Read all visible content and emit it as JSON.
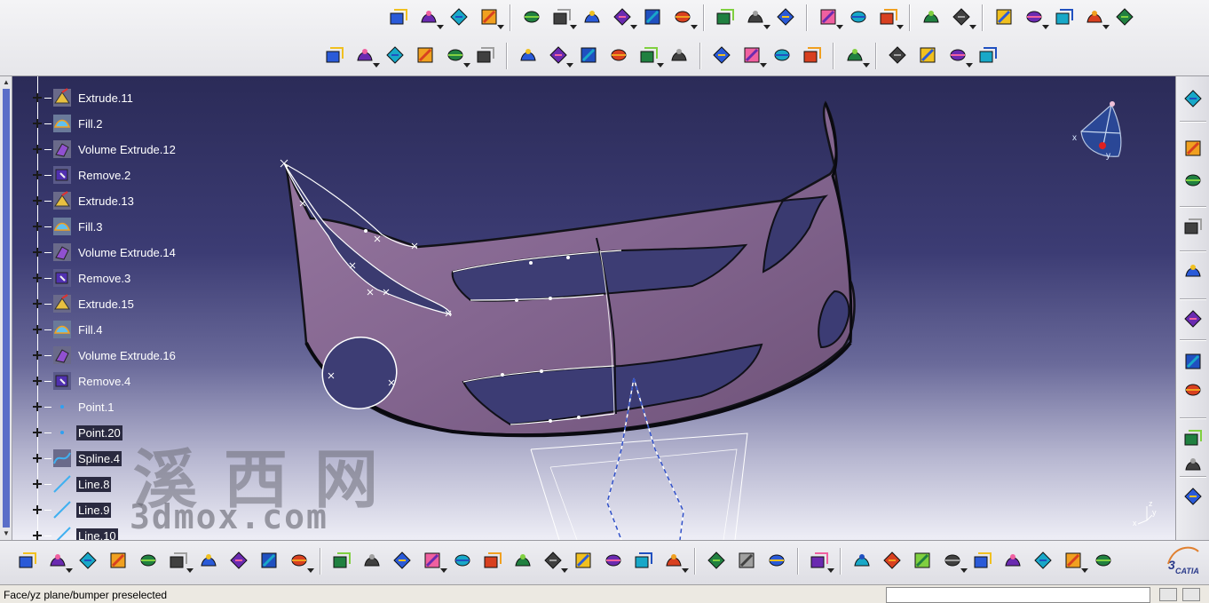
{
  "spec_tree": {
    "items": [
      {
        "label": "Extrude.11",
        "icon": "extrude-icon"
      },
      {
        "label": "Fill.2",
        "icon": "fill-icon"
      },
      {
        "label": "Volume Extrude.12",
        "icon": "volume-extrude-icon"
      },
      {
        "label": "Remove.2",
        "icon": "remove-icon"
      },
      {
        "label": "Extrude.13",
        "icon": "extrude-icon"
      },
      {
        "label": "Fill.3",
        "icon": "fill-icon"
      },
      {
        "label": "Volume Extrude.14",
        "icon": "volume-extrude-icon"
      },
      {
        "label": "Remove.3",
        "icon": "remove-icon"
      },
      {
        "label": "Extrude.15",
        "icon": "extrude-icon"
      },
      {
        "label": "Fill.4",
        "icon": "fill-icon"
      },
      {
        "label": "Volume Extrude.16",
        "icon": "volume-extrude-icon"
      },
      {
        "label": "Remove.4",
        "icon": "remove-icon"
      },
      {
        "label": "Point.1",
        "icon": "point-icon"
      },
      {
        "label": "Point.20",
        "icon": "point-icon"
      },
      {
        "label": "Spline.4",
        "icon": "spline-icon"
      },
      {
        "label": "Line.8",
        "icon": "line-icon"
      },
      {
        "label": "Line.9",
        "icon": "line-icon"
      },
      {
        "label": "Line.10",
        "icon": "line-icon"
      }
    ]
  },
  "viewport": {
    "watermark_chinese": "溪西网",
    "watermark_url": "3dmox.com",
    "compass_axes": {
      "x": "x",
      "y": "y"
    },
    "triad_axes": {
      "x": "x",
      "y": "y",
      "z": "z"
    },
    "colors": {
      "model": "#8a6a90",
      "background_top": "#2b2b58",
      "background_bottom": "#eeeef6"
    }
  },
  "toolbars": {
    "top_row_1": [
      "sketch-icon",
      "extrude-icon",
      "revolve-icon",
      "sweep-icon",
      "|",
      "grid-icon",
      "wireframe-icon",
      "surface-icon",
      "curve-icon",
      "multi-section-icon",
      "boundary-icon",
      "|",
      "point-icon",
      "line-icon",
      "plane-icon",
      "|",
      "fill-icon",
      "join-icon",
      "split-icon",
      "|",
      "fillet-icon",
      "connect-curve-icon",
      "|",
      "transform-icon",
      "pattern-icon",
      "catalog-icon",
      "analysis-icon",
      "material-icon"
    ],
    "top_row_2": [
      "offset-icon",
      "blend-icon",
      "draft-icon",
      "trim-icon",
      "extract-icon",
      "shell-icon",
      "|",
      "volume-extrude-icon",
      "volume-revolve-icon",
      "volume-sweep-icon",
      "volume-fill-icon",
      "thickness-icon",
      "close-surface-icon",
      "|",
      "add-icon",
      "remove-icon",
      "intersect-icon",
      "union-trim-icon",
      "|",
      "boolean-icon",
      "|",
      "assemble-icon",
      "remove-lump-icon",
      "remove-face-icon",
      "split-body-icon"
    ],
    "bottom": [
      "new-icon",
      "open-icon",
      "save-icon",
      "print-icon",
      "cut-icon",
      "copy-icon",
      "paste-icon",
      "undo-icon",
      "redo-icon",
      "whats-this-icon",
      "|",
      "fly-mode-icon",
      "fit-all-icon",
      "pan-icon",
      "rotate-icon",
      "zoom-in-icon",
      "zoom-out-icon",
      "normal-view-icon",
      "multi-view-icon",
      "iso-view-icon",
      "shading-icon",
      "hide-show-icon",
      "swap-space-icon",
      "|",
      "measure-icon",
      "measure-inertia-icon",
      "apply-material-icon",
      "|",
      "capture-icon",
      "|",
      "update-icon",
      "manipulate-icon",
      "axis-icon",
      "structure-icon",
      "grid-snap-icon",
      "work-on-support-icon",
      "3d-work-icon",
      "constraint-icon",
      "compass-reset-icon"
    ],
    "right": [
      "workbench-icon",
      "select-icon",
      "tools-icon",
      "sketch-analysis-icon",
      "curvature-icon",
      "repair-icon",
      "globe-icon",
      "render-icon",
      "light-icon",
      "environment-icon",
      "camera-icon"
    ]
  },
  "status_bar": {
    "message": "Face/yz plane/bumper preselected",
    "command_value": ""
  },
  "brand": {
    "logo_text": "CATIA"
  }
}
